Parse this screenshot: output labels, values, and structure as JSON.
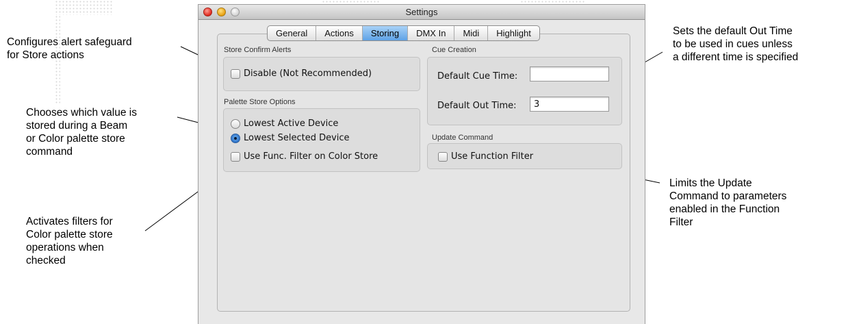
{
  "window": {
    "title": "Settings",
    "tabs": [
      {
        "label": "General",
        "selected": false
      },
      {
        "label": "Actions",
        "selected": false
      },
      {
        "label": "Storing",
        "selected": true
      },
      {
        "label": "DMX In",
        "selected": false
      },
      {
        "label": "Midi",
        "selected": false
      },
      {
        "label": "Highlight",
        "selected": false
      }
    ]
  },
  "store_confirm": {
    "label": "Store Confirm Alerts",
    "disable": {
      "label": "Disable (Not Recommended)",
      "checked": false
    }
  },
  "palette_store": {
    "label": "Palette Store Options",
    "lowest_active": {
      "label": "Lowest Active Device",
      "selected": false
    },
    "lowest_selected": {
      "label": "Lowest Selected Device",
      "selected": true
    },
    "func_filter": {
      "label": "Use Func. Filter on Color Store",
      "checked": false
    }
  },
  "cue_creation": {
    "label": "Cue Creation",
    "cue_time": {
      "label": "Default Cue Time:",
      "value": ""
    },
    "out_time": {
      "label": "Default Out Time:",
      "value": "3"
    }
  },
  "update_command": {
    "label": "Update Command",
    "function_filter": {
      "label": "Use Function Filter",
      "checked": false
    }
  },
  "callouts": {
    "alert": [
      "Configures alert safeguard",
      "for Store actions"
    ],
    "palette": [
      "Chooses which value is",
      "stored during a Beam",
      "or Color palette store",
      "command"
    ],
    "filter": [
      "Activates filters for",
      "Color palette store",
      "operations when",
      "checked"
    ],
    "out_time": [
      "Sets the default Out Time",
      "to be used in cues unless",
      "a different time is specified"
    ],
    "update": [
      "Limits the Update",
      "Command to parameters",
      "enabled in the Function",
      "Filter"
    ]
  },
  "colors": {
    "tab_selected": "#5ea2e6",
    "window_bg": "#e8e8e8",
    "close_button": "#e0281c",
    "minimize_button": "#e8a010"
  }
}
